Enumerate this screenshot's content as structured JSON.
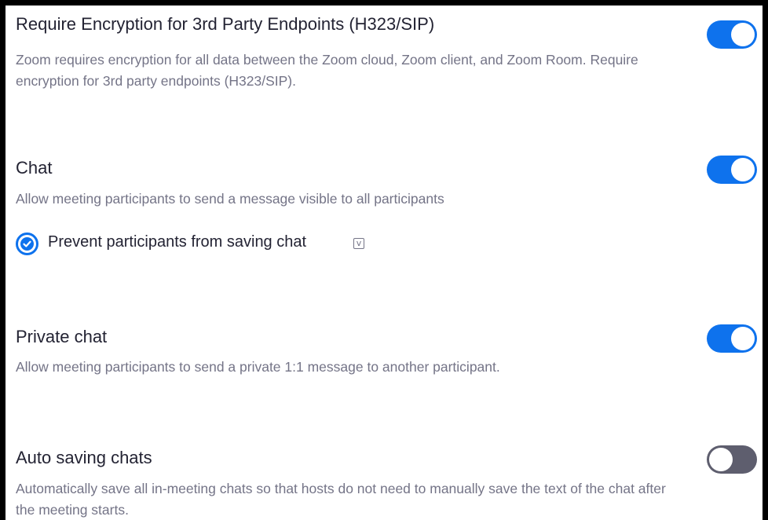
{
  "settings": [
    {
      "title": "Require Encryption for 3rd Party Endpoints (H323/SIP)",
      "description": "Zoom requires encryption for all data between the Zoom cloud, Zoom client, and Zoom Room. Require encryption for 3rd party endpoints (H323/SIP).",
      "enabled": true
    },
    {
      "title": "Chat",
      "description": "Allow meeting participants to send a message visible to all participants",
      "enabled": true,
      "sub_option": {
        "label": "Prevent participants from saving chat",
        "checked": true,
        "icon": "v-badge-icon",
        "icon_glyph": "v"
      }
    },
    {
      "title": "Private chat",
      "description": "Allow meeting participants to send a private 1:1 message to another participant.",
      "enabled": true
    },
    {
      "title": "Auto saving chats",
      "description": "Automatically save all in-meeting chats so that hosts do not need to manually save the text of the chat after the meeting starts.",
      "enabled": false
    }
  ],
  "colors": {
    "toggle_on": "#0e72ed",
    "toggle_off": "#5e5e6e",
    "title_text": "#232333",
    "description_text": "#747487"
  }
}
